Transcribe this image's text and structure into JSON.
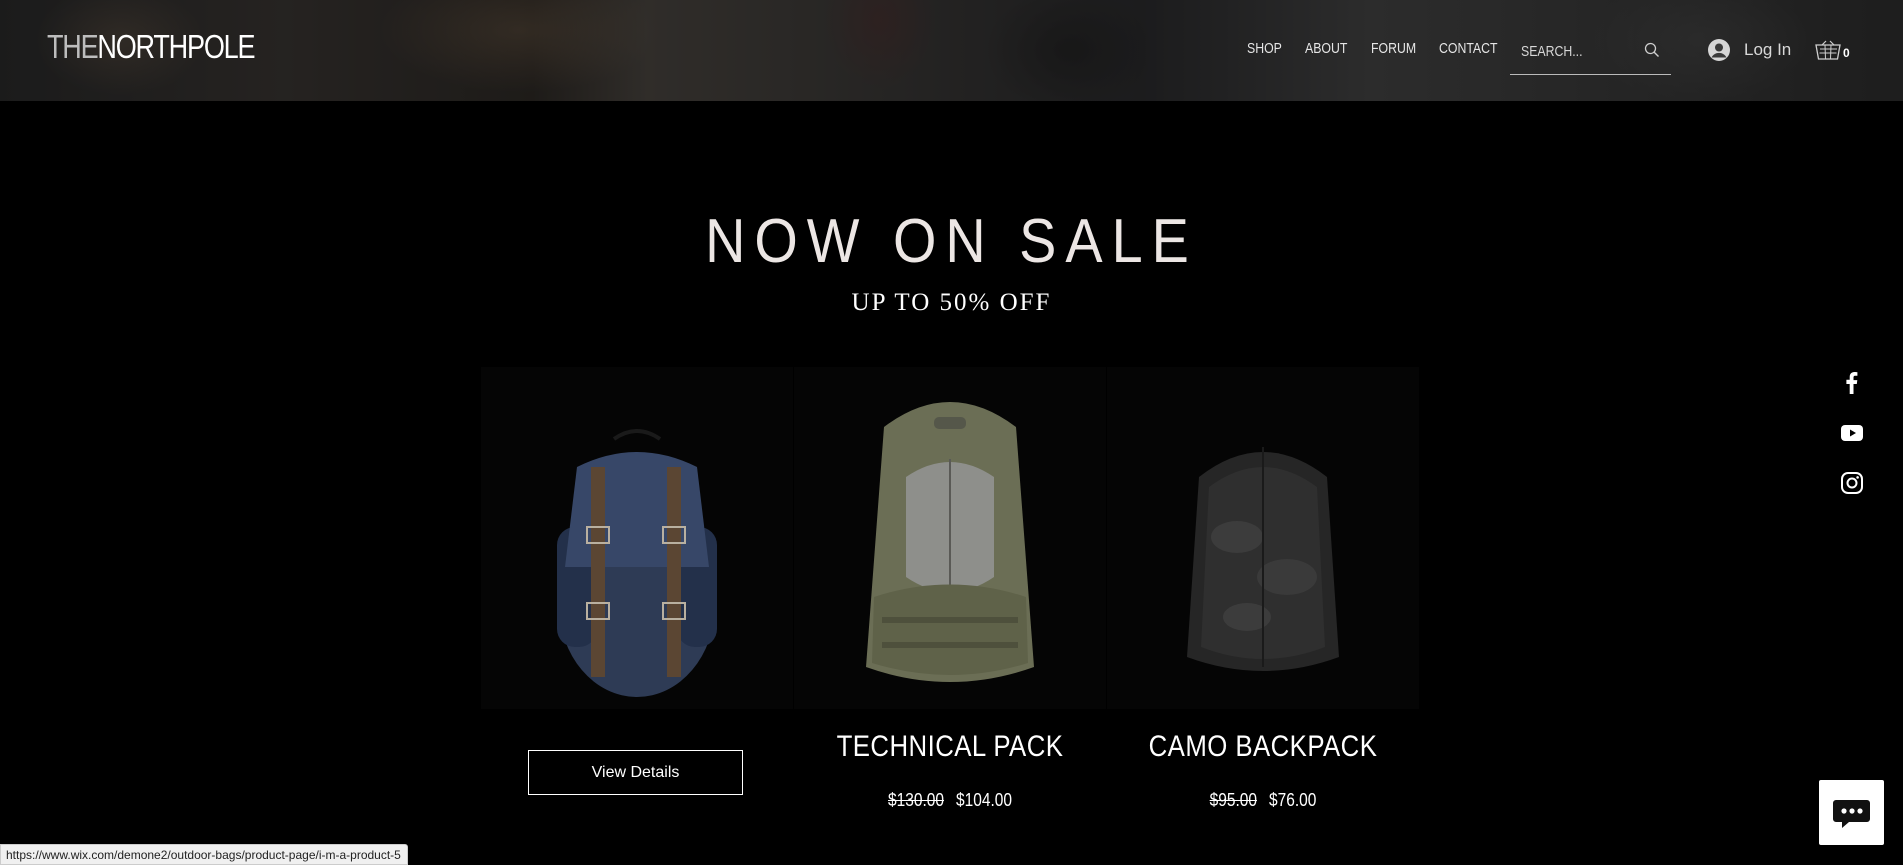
{
  "header": {
    "logo_the": "THE",
    "logo_rest": "NORTHPOLE",
    "nav": [
      {
        "label": "SHOP"
      },
      {
        "label": "ABOUT"
      },
      {
        "label": "FORUM"
      },
      {
        "label": "CONTACT"
      }
    ],
    "search_placeholder": "SEARCH...",
    "login_label": "Log In",
    "cart_count": "0"
  },
  "hero": {
    "title": "NOW ON SALE",
    "subtitle": "UP TO 50% OFF"
  },
  "products": [
    {
      "name": "",
      "button_label": "View Details"
    },
    {
      "name": "TECHNICAL PACK",
      "old_price": "$130.00",
      "price": "$104.00"
    },
    {
      "name": "CAMO BACKPACK",
      "old_price": "$95.00",
      "price": "$76.00"
    }
  ],
  "social": [
    "facebook-icon",
    "youtube-icon",
    "instagram-icon"
  ],
  "status_url": "https://www.wix.com/demone2/outdoor-bags/product-page/i-m-a-product-5",
  "colors": {
    "background": "#000000",
    "title": "#ece6e4",
    "nav_text": "#e6e6e6"
  }
}
